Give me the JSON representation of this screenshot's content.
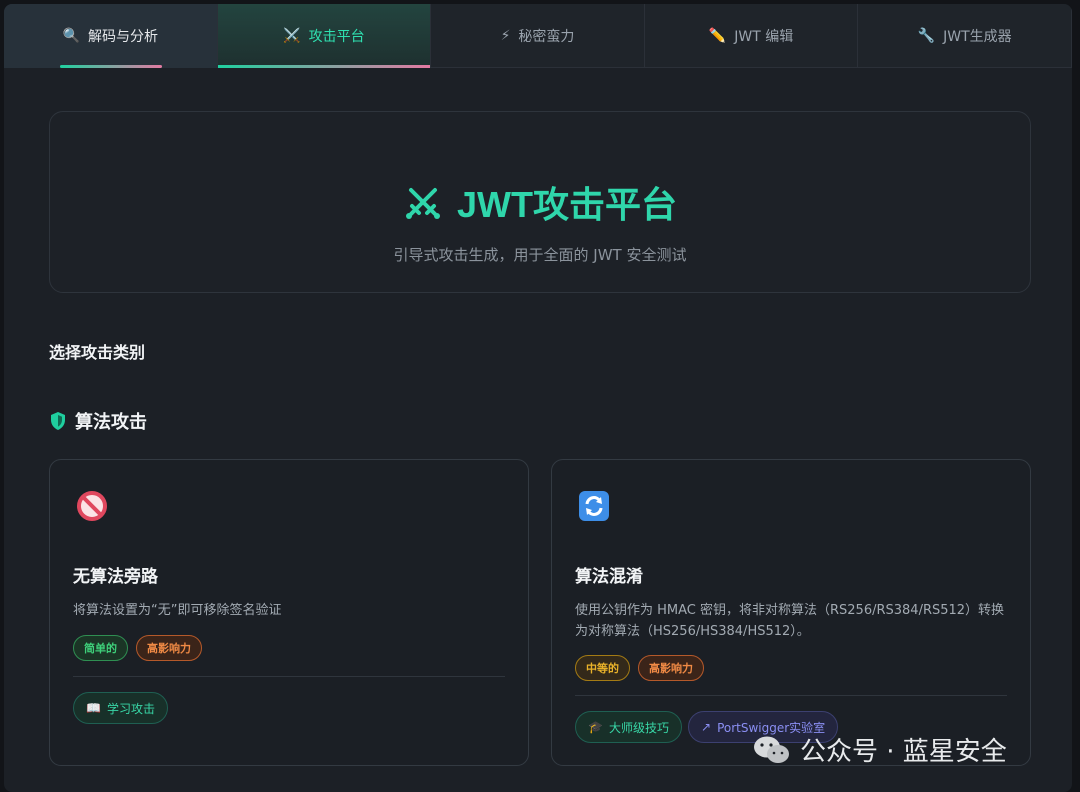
{
  "tabs": [
    {
      "icon": "🔍",
      "label": "解码与分析"
    },
    {
      "icon": "⚔️",
      "label": "攻击平台"
    },
    {
      "icon": "⚡",
      "label": "秘密蛮力"
    },
    {
      "icon": "✏️",
      "label": "JWT 编辑"
    },
    {
      "icon": "🔧",
      "label": "JWT生成器"
    }
  ],
  "hero": {
    "title": "JWT攻击平台",
    "subtitle": "引导式攻击生成，用于全面的 JWT 安全测试"
  },
  "section_label": "选择攻击类别",
  "category": {
    "title": "算法攻击",
    "icon": "shield-icon"
  },
  "cards": [
    {
      "icon": "prohibited-icon",
      "title": "无算法旁路",
      "desc": "将算法设置为“无”即可移除签名验证",
      "tags": [
        "简单的",
        "高影响力"
      ],
      "actions": [
        "学习攻击"
      ]
    },
    {
      "icon": "refresh-icon",
      "title": "算法混淆",
      "desc": "使用公钥作为 HMAC 密钥，将非对称算法（RS256/RS384/RS512）转换为对称算法（HS256/HS384/HS512）。",
      "tags": [
        "中等的",
        "高影响力"
      ],
      "actions": [
        "大师级技巧",
        "PortSwigger实验室"
      ]
    }
  ],
  "watermark": "公众号 · 蓝星安全",
  "colors": {
    "accent": "#2fd6ab",
    "background": "#1c2026"
  }
}
